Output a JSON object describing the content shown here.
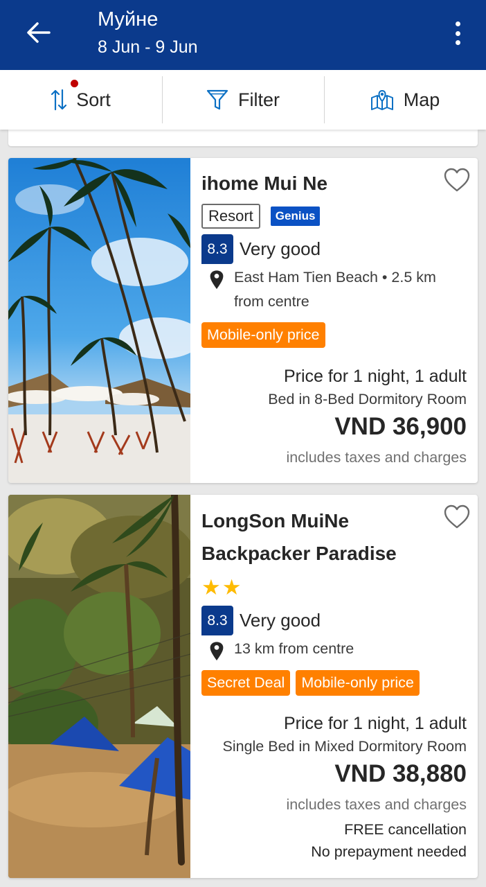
{
  "header": {
    "title": "Муйне",
    "dates": "8 Jun - 9 Jun",
    "background_color": "#0b3a8c"
  },
  "toolbar": {
    "sort_label": "Sort",
    "filter_label": "Filter",
    "map_label": "Map"
  },
  "hotels": [
    {
      "name": "ihome Mui Ne",
      "type": "Resort",
      "genius": "Genius",
      "score": "8.3",
      "rating_word": "Very good",
      "location": "East Ham Tien Beach • 2.5 km from centre",
      "tags": [
        "Mobile-only price"
      ],
      "price_for": "Price for 1 night, 1 adult",
      "room": "Bed in 8-Bed Dormitory Room",
      "price": "VND 36,900",
      "taxes": "includes taxes and charges"
    },
    {
      "name": "LongSon MuiNe Backpacker Paradise",
      "stars": "★★",
      "star_count": 2,
      "score": "8.3",
      "rating_word": "Very good",
      "location": "13 km from centre",
      "tags": [
        "Secret Deal",
        "Mobile-only price"
      ],
      "price_for": "Price for 1 night, 1 adult",
      "room": "Single Bed in Mixed Dormitory Room",
      "price": "VND 38,880",
      "taxes": "includes taxes and charges",
      "cancellation": "FREE cancellation",
      "prepayment": "No prepayment needed"
    }
  ],
  "colors": {
    "brand_blue": "#0b3a8c",
    "genius_blue": "#0b52c4",
    "deal_orange": "#ff8000",
    "star_yellow": "#febb02"
  }
}
